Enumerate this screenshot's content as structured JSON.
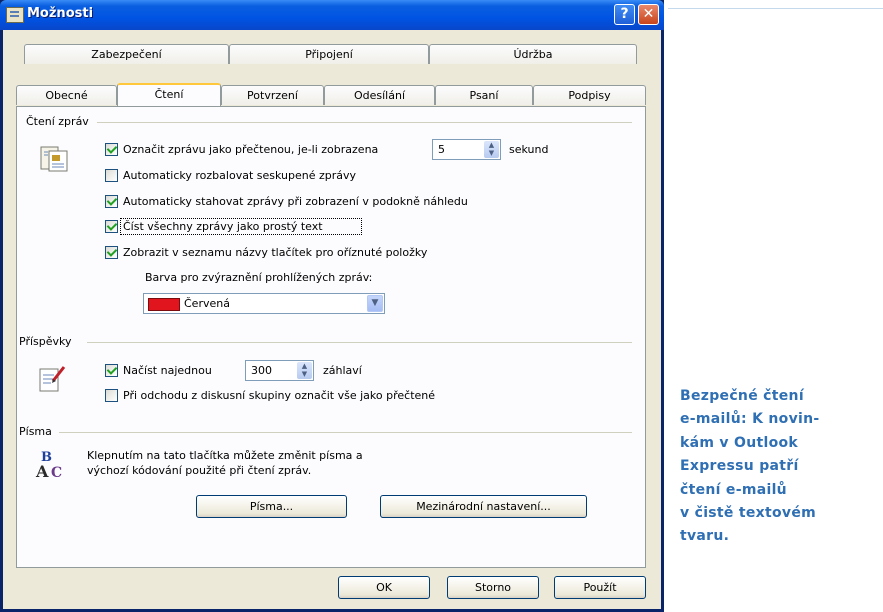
{
  "window": {
    "title": "Možnosti",
    "help_label": "?",
    "close_label": "✕"
  },
  "tabs_row1": [
    "Zabezpečení",
    "Připojení",
    "Údržba"
  ],
  "tabs_row2": [
    "Obecné",
    "Čtení",
    "Potvrzení",
    "Odesílání",
    "Psaní",
    "Podpisy"
  ],
  "active_tab": "Čtení",
  "reading": {
    "group_label": "Čtení zpráv",
    "mark_read_label": "Označit zprávu jako přečtenou, je-li zobrazena",
    "mark_read_checked": true,
    "mark_read_seconds": "5",
    "seconds_label": "sekund",
    "expand_threads_label": "Automaticky rozbalovat seskupené zprávy",
    "expand_threads_checked": false,
    "auto_download_label": "Automaticky stahovat zprávy při zobrazení v podokně náhledu",
    "auto_download_checked": true,
    "plain_text_label": "Číst všechny zprávy jako prostý text",
    "plain_text_checked": true,
    "tooltips_label": "Zobrazit v seznamu názvy tlačítek pro oříznuté položky",
    "tooltips_checked": true,
    "highlight_color_label": "Barva pro zvýraznění prohlížených zpráv:",
    "highlight_color_value": "Červená",
    "highlight_color_hex": "#e0151d"
  },
  "news": {
    "group_label": "Příspěvky",
    "fetch_label": "Načíst najednou",
    "fetch_checked": true,
    "fetch_count": "300",
    "headers_label": "záhlaví",
    "mark_all_read_label": "Při odchodu z diskusní skupiny označit vše jako přečtené",
    "mark_all_read_checked": false
  },
  "fonts": {
    "group_label": "Písma",
    "description_line1": "Klepnutím na tato tlačítka můžete změnit písma a",
    "description_line2": "výchozí kódování použité při čtení zpráv.",
    "fonts_button": "Písma...",
    "intl_button": "Mezinárodní nastavení..."
  },
  "footer": {
    "ok": "OK",
    "cancel": "Storno",
    "apply": "Použít"
  },
  "caption": {
    "lines": [
      "Bezpečné čtení",
      "e-mailů: K novin-",
      "kám v Outlook",
      "Expressu patří",
      "čtení e-mailů",
      "v čistě textovém",
      "tvaru."
    ],
    "color": "#2f6fb3"
  }
}
